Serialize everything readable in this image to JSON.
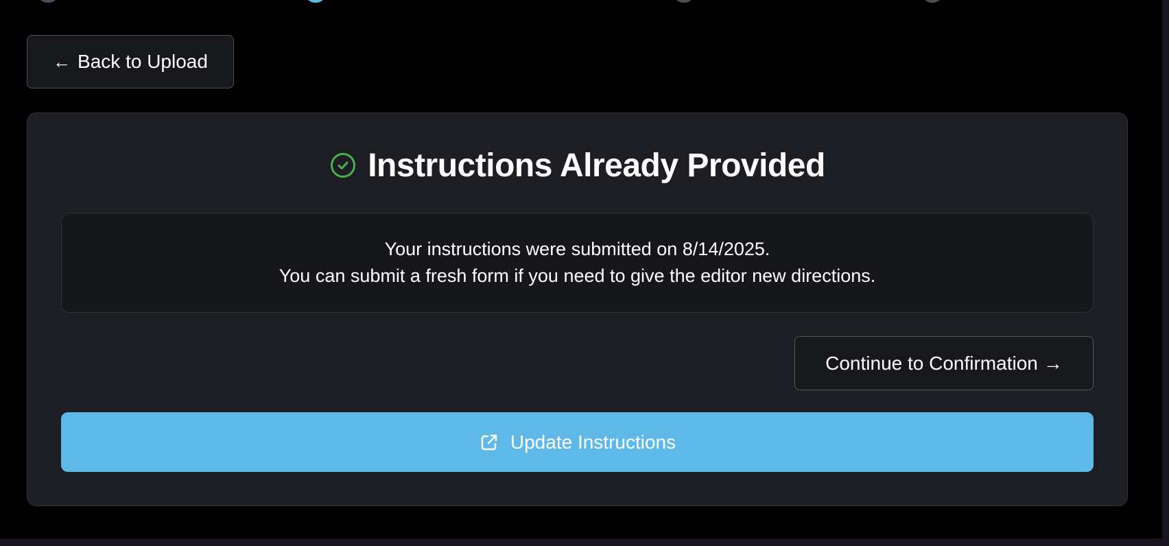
{
  "stepper": {
    "steps": [
      "inactive",
      "active",
      "inactive",
      "inactive"
    ]
  },
  "nav": {
    "back_arrow": "←",
    "back_label": "Back to Upload"
  },
  "card": {
    "title": "Instructions Already Provided",
    "status_icon": "check-circle-icon",
    "info_line_1": "Your instructions were submitted on 8/14/2025.",
    "info_line_2": "You can submit a fresh form if you need to give the editor new directions.",
    "continue_label": "Continue to Confirmation",
    "continue_arrow": "→",
    "update_label": "Update Instructions",
    "update_icon": "external-link-icon"
  },
  "colors": {
    "page_background": "#000000",
    "card_background": "#1d1e23",
    "info_background": "#15171b",
    "accent": "#5fb9e8",
    "success": "#4caf50",
    "text": "#ffffff"
  }
}
